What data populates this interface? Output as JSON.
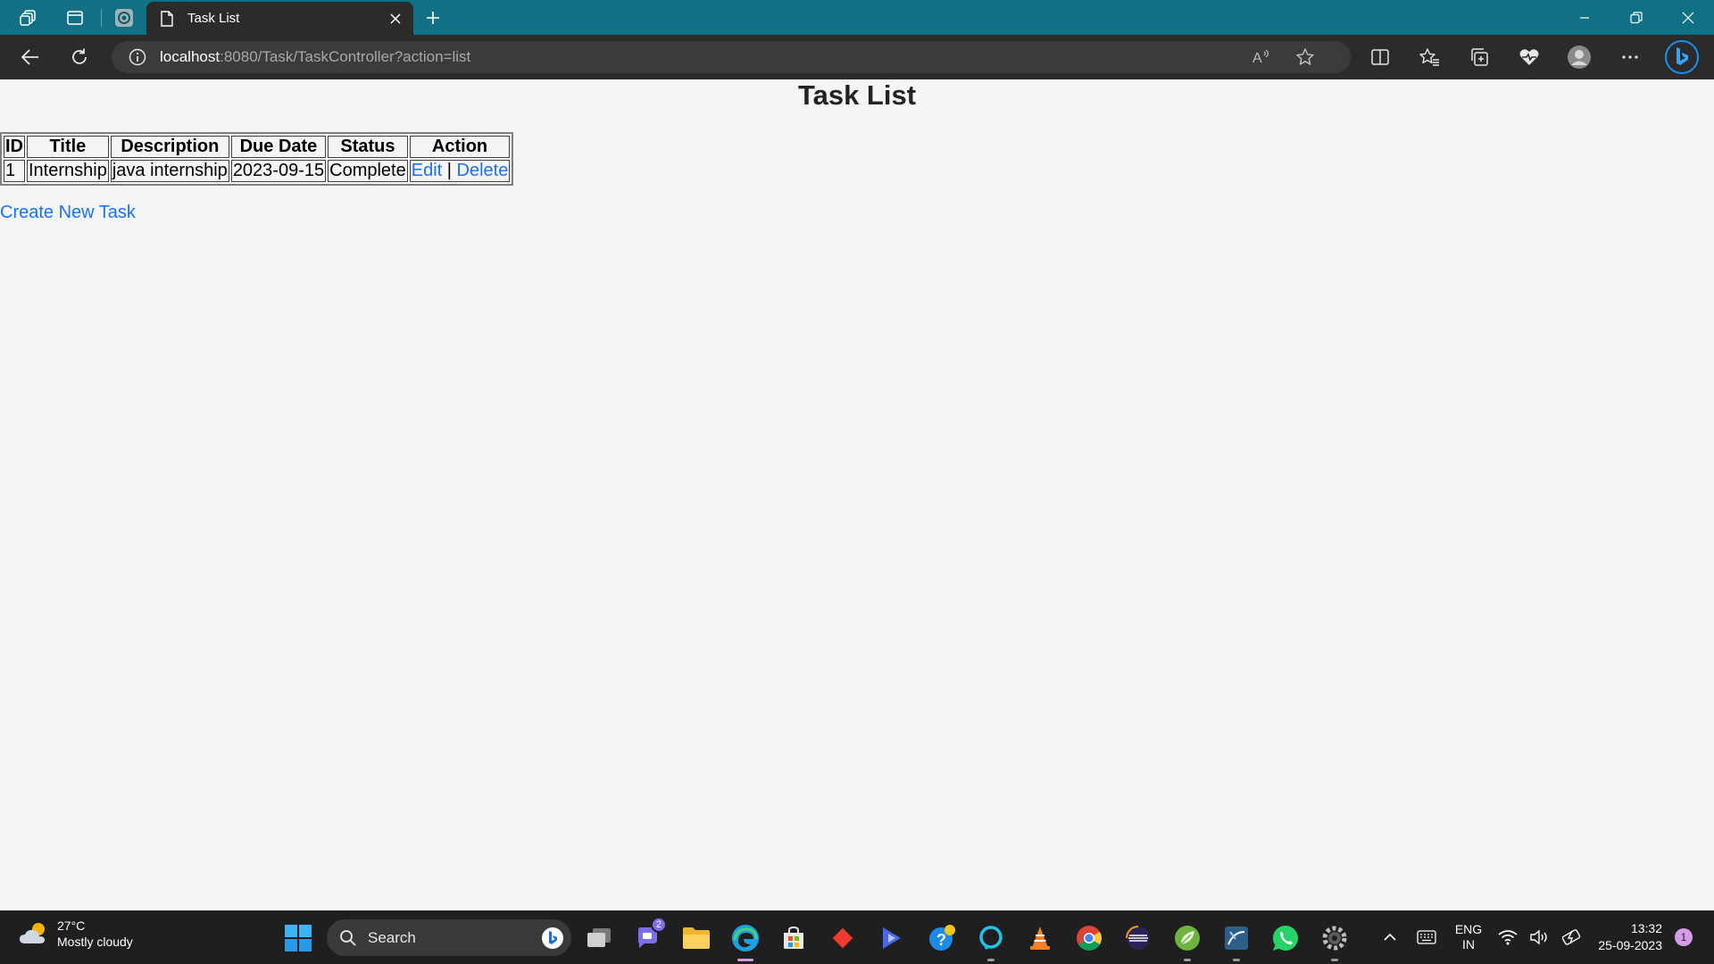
{
  "browser": {
    "tab": {
      "title": "Task List"
    },
    "address": {
      "host": "localhost",
      "path": ":8080/Task/TaskController?action=list"
    }
  },
  "page": {
    "heading": "Task List",
    "table": {
      "headers": [
        "ID",
        "Title",
        "Description",
        "Due Date",
        "Status",
        "Action"
      ],
      "rows": [
        {
          "id": "1",
          "title": "Internship",
          "description": "java internship",
          "due_date": "2023-09-15",
          "status": "Complete",
          "edit": "Edit",
          "separator": "|",
          "delete": "Delete"
        }
      ]
    },
    "create_link": "Create New Task",
    "link_color": "#1a73e8"
  },
  "taskbar": {
    "weather": {
      "temp": "27°C",
      "condition": "Mostly cloudy"
    },
    "search_label": "Search",
    "chat_badge": "2",
    "language": {
      "line1": "ENG",
      "line2": "IN"
    },
    "clock": {
      "time": "13:32",
      "date": "25-09-2023"
    },
    "notification_count": "1"
  },
  "colors": {
    "titlebar": "#0f7183",
    "toolbar": "#2b2b2b",
    "taskbar": "#1f1f1f"
  }
}
